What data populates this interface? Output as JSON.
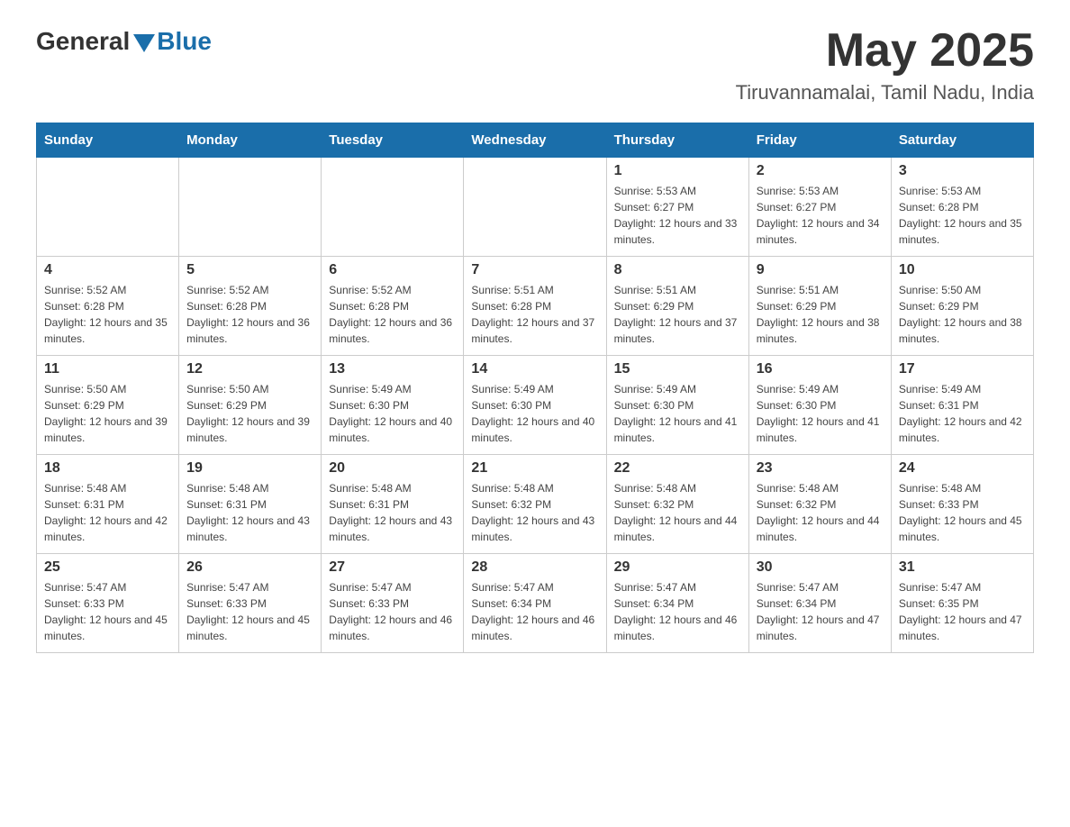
{
  "header": {
    "logo_general": "General",
    "logo_blue": "Blue",
    "month_title": "May 2025",
    "location": "Tiruvannamalai, Tamil Nadu, India"
  },
  "days_of_week": [
    "Sunday",
    "Monday",
    "Tuesday",
    "Wednesday",
    "Thursday",
    "Friday",
    "Saturday"
  ],
  "weeks": [
    [
      {
        "day": "",
        "info": ""
      },
      {
        "day": "",
        "info": ""
      },
      {
        "day": "",
        "info": ""
      },
      {
        "day": "",
        "info": ""
      },
      {
        "day": "1",
        "info": "Sunrise: 5:53 AM\nSunset: 6:27 PM\nDaylight: 12 hours and 33 minutes."
      },
      {
        "day": "2",
        "info": "Sunrise: 5:53 AM\nSunset: 6:27 PM\nDaylight: 12 hours and 34 minutes."
      },
      {
        "day": "3",
        "info": "Sunrise: 5:53 AM\nSunset: 6:28 PM\nDaylight: 12 hours and 35 minutes."
      }
    ],
    [
      {
        "day": "4",
        "info": "Sunrise: 5:52 AM\nSunset: 6:28 PM\nDaylight: 12 hours and 35 minutes."
      },
      {
        "day": "5",
        "info": "Sunrise: 5:52 AM\nSunset: 6:28 PM\nDaylight: 12 hours and 36 minutes."
      },
      {
        "day": "6",
        "info": "Sunrise: 5:52 AM\nSunset: 6:28 PM\nDaylight: 12 hours and 36 minutes."
      },
      {
        "day": "7",
        "info": "Sunrise: 5:51 AM\nSunset: 6:28 PM\nDaylight: 12 hours and 37 minutes."
      },
      {
        "day": "8",
        "info": "Sunrise: 5:51 AM\nSunset: 6:29 PM\nDaylight: 12 hours and 37 minutes."
      },
      {
        "day": "9",
        "info": "Sunrise: 5:51 AM\nSunset: 6:29 PM\nDaylight: 12 hours and 38 minutes."
      },
      {
        "day": "10",
        "info": "Sunrise: 5:50 AM\nSunset: 6:29 PM\nDaylight: 12 hours and 38 minutes."
      }
    ],
    [
      {
        "day": "11",
        "info": "Sunrise: 5:50 AM\nSunset: 6:29 PM\nDaylight: 12 hours and 39 minutes."
      },
      {
        "day": "12",
        "info": "Sunrise: 5:50 AM\nSunset: 6:29 PM\nDaylight: 12 hours and 39 minutes."
      },
      {
        "day": "13",
        "info": "Sunrise: 5:49 AM\nSunset: 6:30 PM\nDaylight: 12 hours and 40 minutes."
      },
      {
        "day": "14",
        "info": "Sunrise: 5:49 AM\nSunset: 6:30 PM\nDaylight: 12 hours and 40 minutes."
      },
      {
        "day": "15",
        "info": "Sunrise: 5:49 AM\nSunset: 6:30 PM\nDaylight: 12 hours and 41 minutes."
      },
      {
        "day": "16",
        "info": "Sunrise: 5:49 AM\nSunset: 6:30 PM\nDaylight: 12 hours and 41 minutes."
      },
      {
        "day": "17",
        "info": "Sunrise: 5:49 AM\nSunset: 6:31 PM\nDaylight: 12 hours and 42 minutes."
      }
    ],
    [
      {
        "day": "18",
        "info": "Sunrise: 5:48 AM\nSunset: 6:31 PM\nDaylight: 12 hours and 42 minutes."
      },
      {
        "day": "19",
        "info": "Sunrise: 5:48 AM\nSunset: 6:31 PM\nDaylight: 12 hours and 43 minutes."
      },
      {
        "day": "20",
        "info": "Sunrise: 5:48 AM\nSunset: 6:31 PM\nDaylight: 12 hours and 43 minutes."
      },
      {
        "day": "21",
        "info": "Sunrise: 5:48 AM\nSunset: 6:32 PM\nDaylight: 12 hours and 43 minutes."
      },
      {
        "day": "22",
        "info": "Sunrise: 5:48 AM\nSunset: 6:32 PM\nDaylight: 12 hours and 44 minutes."
      },
      {
        "day": "23",
        "info": "Sunrise: 5:48 AM\nSunset: 6:32 PM\nDaylight: 12 hours and 44 minutes."
      },
      {
        "day": "24",
        "info": "Sunrise: 5:48 AM\nSunset: 6:33 PM\nDaylight: 12 hours and 45 minutes."
      }
    ],
    [
      {
        "day": "25",
        "info": "Sunrise: 5:47 AM\nSunset: 6:33 PM\nDaylight: 12 hours and 45 minutes."
      },
      {
        "day": "26",
        "info": "Sunrise: 5:47 AM\nSunset: 6:33 PM\nDaylight: 12 hours and 45 minutes."
      },
      {
        "day": "27",
        "info": "Sunrise: 5:47 AM\nSunset: 6:33 PM\nDaylight: 12 hours and 46 minutes."
      },
      {
        "day": "28",
        "info": "Sunrise: 5:47 AM\nSunset: 6:34 PM\nDaylight: 12 hours and 46 minutes."
      },
      {
        "day": "29",
        "info": "Sunrise: 5:47 AM\nSunset: 6:34 PM\nDaylight: 12 hours and 46 minutes."
      },
      {
        "day": "30",
        "info": "Sunrise: 5:47 AM\nSunset: 6:34 PM\nDaylight: 12 hours and 47 minutes."
      },
      {
        "day": "31",
        "info": "Sunrise: 5:47 AM\nSunset: 6:35 PM\nDaylight: 12 hours and 47 minutes."
      }
    ]
  ]
}
